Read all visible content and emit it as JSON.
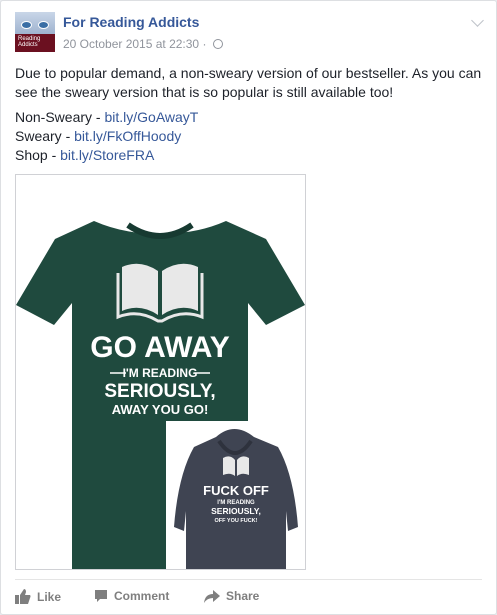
{
  "post": {
    "page_name": "For Reading Addicts",
    "avatar_text": "Reading Addicts",
    "timestamp": "20 October 2015 at 22:30",
    "separator": "·",
    "body": "Due to popular demand, a non-sweary version of our bestseller. As you can see the sweary version that is so popular is still available too!",
    "links": [
      {
        "label": "Non-Sweary - ",
        "url": "bit.ly/GoAwayT"
      },
      {
        "label": "Sweary - ",
        "url": "bit.ly/FkOffHoody"
      },
      {
        "label": "Shop - ",
        "url": "bit.ly/StoreFRA"
      }
    ]
  },
  "image": {
    "tshirt_text": [
      "GO AWAY",
      "I'M READING",
      "SERIOUSLY,",
      "AWAY YOU GO!"
    ],
    "hoodie_text": [
      "FUCK OFF",
      "I'M READING",
      "SERIOUSLY,",
      "OFF YOU FUCK!"
    ],
    "colors": {
      "tshirt": "#1f4a3e",
      "hoodie": "#3f4452"
    }
  },
  "actions": {
    "like": "Like",
    "comment": "Comment",
    "share": "Share"
  },
  "colors": {
    "link": "#365899",
    "meta": "#90949c",
    "action": "#7f7f7f"
  }
}
